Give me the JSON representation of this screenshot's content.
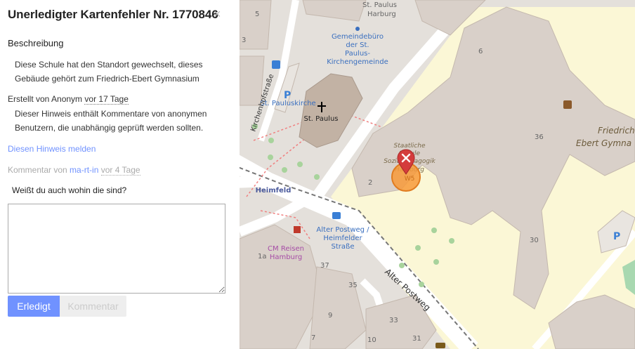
{
  "note": {
    "title": "Unerledigter Kartenfehler Nr. 1770846",
    "close_glyph": "×",
    "description_heading": "Beschreibung",
    "description": "Diese Schule hat den Standort gewechselt, dieses Gebäude gehört zum Friedrich-Ebert Gymnasium",
    "created_prefix": "Erstellt von Anonym",
    "created_date": "vor 17 Tage",
    "anonymous_notice": "Dieser Hinweis enthält Kommentare von anonymen Benutzern, die unabhängig geprüft werden sollten.",
    "report_link": "Diesen Hinweis melden",
    "comment_prefix": "Kommentar von",
    "comment_user": "ma-rt-in",
    "comment_date": "vor 4 Tage",
    "comment_text": "Weißt du auch wohin die sind?",
    "textarea_value": "",
    "resolve_button": "Erledigt",
    "comment_button": "Kommentar"
  },
  "map": {
    "labels": {
      "church_district": "St. Paulus",
      "church_district2": "Harburg",
      "office1": "Gemeindebüro",
      "office2": "der St.",
      "office3": "Paulus-",
      "office4": "Kirchengemeinde",
      "parking_church": "St. Pauluskirche",
      "church": "St. Paulus",
      "street_upper": "Kirchenhofstraße",
      "heimfeld": "Heimfeld",
      "busstop1": "Alter Postweg /",
      "busstop2": "Heimfelder",
      "busstop3": "Straße",
      "shop1": "CM Reisen",
      "shop2": "Hamburg",
      "street_main": "Alter Postweg",
      "school1": "Staatliche",
      "school2": "Schule",
      "school3": "Sozialpädagogik",
      "school4": "Hamburg",
      "school5": "W5",
      "gym1": "Friedrich-",
      "gym2": "Ebert Gymna",
      "hn_5": "5",
      "hn_3": "3",
      "hn_6": "6",
      "hn_36": "36",
      "hn_2": "2",
      "hn_1a": "1a",
      "hn_37": "37",
      "hn_35": "35",
      "hn_9": "9",
      "hn_7": "7",
      "hn_33": "33",
      "hn_10": "10",
      "hn_31": "31",
      "hn_30": "30",
      "parking": "P"
    },
    "colors": {
      "school_area": "#fbf7d6",
      "building": "#d9d0c9",
      "road": "#ffffff",
      "marker": "#d43c3c",
      "highlight": "#f79a3a"
    }
  }
}
